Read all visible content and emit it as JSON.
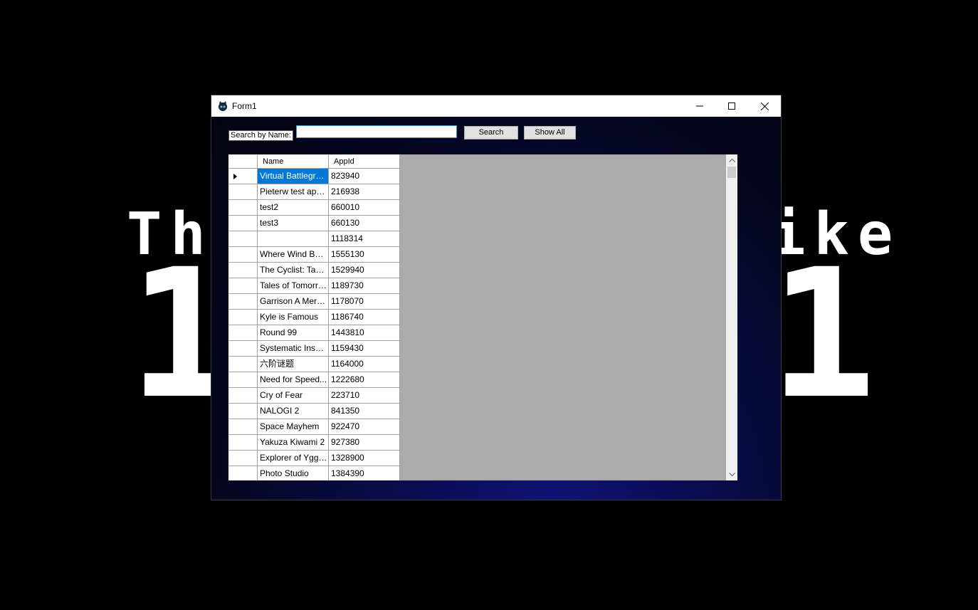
{
  "wallpaper": {
    "line1_left": "The",
    "line1_right": "ike",
    "line2_left": "1",
    "line2_right": "1"
  },
  "window": {
    "title": "Form1"
  },
  "search": {
    "label": "Search by Name:",
    "value": "",
    "search_button": "Search",
    "show_all_button": "Show All"
  },
  "grid": {
    "columns": [
      "Name",
      "AppId"
    ],
    "rows": [
      {
        "name": "Virtual Battlegrou...",
        "appid": "823940"
      },
      {
        "name": "Pieterw test app7...",
        "appid": "216938"
      },
      {
        "name": "test2",
        "appid": "660010"
      },
      {
        "name": "test3",
        "appid": "660130"
      },
      {
        "name": "",
        "appid": "1118314"
      },
      {
        "name": "Where Wind Bec...",
        "appid": "1555130"
      },
      {
        "name": "The Cyclist: Tacti...",
        "appid": "1529940"
      },
      {
        "name": "Tales of Tomorro...",
        "appid": "1189730"
      },
      {
        "name": "Garrison A Merce...",
        "appid": "1178070"
      },
      {
        "name": "Kyle is Famous",
        "appid": "1186740"
      },
      {
        "name": "Round 99",
        "appid": "1443810"
      },
      {
        "name": "Systematic Insanity",
        "appid": "1159430"
      },
      {
        "name": "六阶谜题",
        "appid": "1164000"
      },
      {
        "name": "Need for Speed...",
        "appid": "1222680"
      },
      {
        "name": "Cry of Fear",
        "appid": "223710"
      },
      {
        "name": "NALOGI 2",
        "appid": "841350"
      },
      {
        "name": "Space Mayhem",
        "appid": "922470"
      },
      {
        "name": "Yakuza Kiwami 2",
        "appid": "927380"
      },
      {
        "name": "Explorer of Yggdr...",
        "appid": "1328900"
      },
      {
        "name": "Photo Studio",
        "appid": "1384390"
      }
    ],
    "selected_row": 0
  }
}
